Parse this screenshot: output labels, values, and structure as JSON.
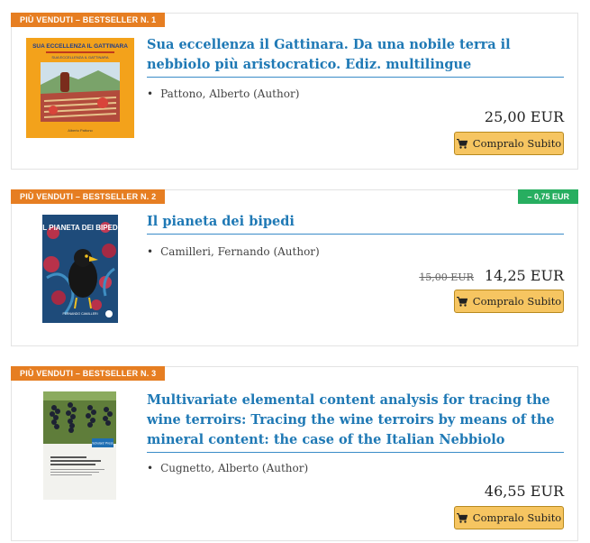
{
  "products": [
    {
      "badge": "PIÙ VENDUTI – BESTSELLER N. 1",
      "title": "Sua eccellenza il Gattinara. Da una nobile terra il nebbiolo più aristocratico. Ediz. multilingue",
      "author": "Pattono, Alberto (Author)",
      "price": "25,00 EUR",
      "button": "Compralo Subito",
      "cover": {
        "title_line1": "SUA ECCELLENZA IL GATTINARA",
        "title_line2": "SUA ECCELLENZA IL GATTINARA",
        "author": "Alberto Pattono",
        "bg_color": "#f3a21b"
      }
    },
    {
      "badge": "PIÙ VENDUTI – BESTSELLER N. 2",
      "discount": "– 0,75 EUR",
      "title": "Il pianeta dei bipedi",
      "author": "Camilleri, Fernando (Author)",
      "old_price": "15,00 EUR",
      "price": "14,25 EUR",
      "button": "Compralo Subito",
      "cover": {
        "title": "IL PIANETA DEI BIPEDI",
        "author": "FERNANDO CAMILLERI",
        "bg_color": "#1e4b7a"
      }
    },
    {
      "badge": "PIÙ VENDUTI – BESTSELLER N. 3",
      "title": "Multivariate elemental content analysis for tracing the wine terroirs: Tracing the wine terroirs by means of the mineral content: the case of the Italian Nebbiolo",
      "author": "Cugnetto, Alberto (Author)",
      "price": "46,55 EUR",
      "button": "Compralo Subito",
      "cover": {
        "publisher": "Scholars' Press",
        "title": "Multivariate elemental content analysis for tracing the wine terroirs",
        "bg_color": "#f2f2ee"
      }
    }
  ],
  "icons": {
    "cart": "shopping-cart-icon"
  },
  "colors": {
    "badge": "#e67e22",
    "discount": "#27ae60",
    "title": "#1f79b5",
    "button": "#f6c561"
  }
}
